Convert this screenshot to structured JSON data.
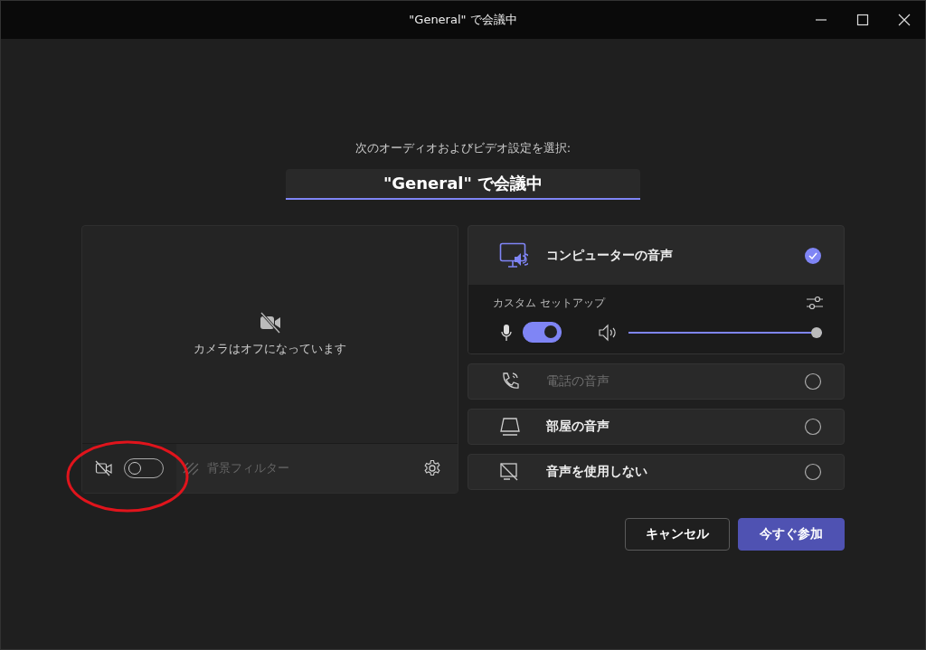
{
  "window": {
    "title": "\"General\" で会議中"
  },
  "prompt": "次のオーディオおよびビデオ設定を選択:",
  "meeting_name": {
    "value": "\"General\" で会議中"
  },
  "camera": {
    "status": "カメラはオフになっています",
    "on": false,
    "background_filter": {
      "label": "背景フィルター",
      "disabled": true
    }
  },
  "audio_options": [
    {
      "kind": "computer",
      "label": "コンピューターの音声",
      "selected": true,
      "disabled": false,
      "custom_setup": {
        "label": "カスタム セットアップ",
        "mic_on": true,
        "speaker": {
          "level": 1.0
        }
      }
    },
    {
      "kind": "phone",
      "label": "電話の音声",
      "selected": false,
      "disabled": true
    },
    {
      "kind": "room",
      "label": "部屋の音声",
      "selected": false,
      "disabled": false
    },
    {
      "kind": "none",
      "label": "音声を使用しない",
      "selected": false,
      "disabled": false
    }
  ],
  "buttons": [
    {
      "kind": "secondary",
      "label": "キャンセル"
    },
    {
      "kind": "primary",
      "label": "今すぐ参加"
    }
  ]
}
